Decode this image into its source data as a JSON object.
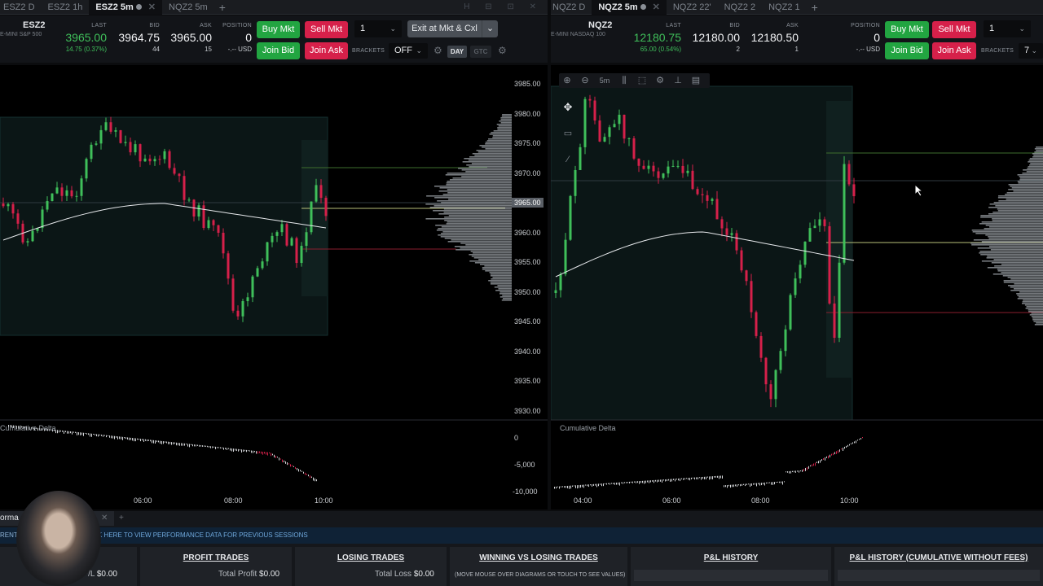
{
  "left_tabs": [
    {
      "label": "ESZ2 D",
      "active": false
    },
    {
      "label": "ESZ2 1h",
      "active": false
    },
    {
      "label": "ESZ2 5m",
      "active": true
    },
    {
      "label": "NQZ2 5m",
      "active": false
    }
  ],
  "right_tabs": [
    {
      "label": "NQZ2 D",
      "active": false
    },
    {
      "label": "NQZ2 5m",
      "active": true
    },
    {
      "label": "NQZ2 22'",
      "active": false
    },
    {
      "label": "NQZ2 2",
      "active": false
    },
    {
      "label": "NQZ2 1",
      "active": false
    }
  ],
  "left_order": {
    "symbol": "ESZ2",
    "symbol_sub": "E-MINI S&P 500",
    "last_label": "LAST",
    "last": "3965.00",
    "last_change": "14.75 (0.37%)",
    "bid_label": "BID",
    "bid": "3964.75",
    "bid_size": "44",
    "ask_label": "ASK",
    "ask": "3965.00",
    "ask_size": "15",
    "position_label": "POSITION",
    "position": "0",
    "position_pnl": "-.-- USD",
    "buy_mkt": "Buy Mkt",
    "sell_mkt": "Sell Mkt",
    "join_bid": "Join Bid",
    "join_ask": "Join Ask",
    "qty": "1",
    "exit_button": "Exit at Mkt & Cxl",
    "brackets_label": "BRACKETS",
    "brackets_value": "OFF",
    "day": "DAY",
    "gtc": "GTC"
  },
  "right_order": {
    "symbol": "NQZ2",
    "symbol_sub": "E-MINI NASDAQ 100",
    "last_label": "LAST",
    "last": "12180.75",
    "last_change": "65.00 (0.54%)",
    "bid_label": "BID",
    "bid": "12180.00",
    "bid_size": "2",
    "ask_label": "ASK",
    "ask": "12180.50",
    "ask_size": "1",
    "position_label": "POSITION",
    "position": "0",
    "position_pnl": "-.-- USD",
    "buy_mkt": "Buy Mkt",
    "sell_mkt": "Sell Mkt",
    "join_bid": "Join Bid",
    "join_ask": "Join Ask",
    "qty": "1",
    "brackets_label": "BRACKETS",
    "brackets_value": "7"
  },
  "left_chart": {
    "price_axis": [
      "3985.00",
      "3980.00",
      "3975.00",
      "3970.00",
      "3965.00",
      "3960.00",
      "3955.00",
      "3950.00",
      "3945.00",
      "3940.00",
      "3935.00",
      "3930.00"
    ],
    "current_price": "3965.00",
    "time_axis": [
      "06:00",
      "08:00",
      "10:00"
    ],
    "cd_title": "Cumulative Delta",
    "cd_axis": [
      "0",
      "-5,000",
      "-10,000"
    ]
  },
  "right_chart": {
    "tool_zoom": "5m",
    "time_axis": [
      "04:00",
      "06:00",
      "08:00",
      "10:00"
    ],
    "cd_title": "Cumulative Delta"
  },
  "bottom": {
    "tab_label": "orma",
    "session_link": "K HERE TO VIEW PERFORMANCE DATA FOR PREVIOUS SESSIONS",
    "rent_label": "RENT",
    "cards": [
      {
        "title": "PROFIT TRADES",
        "sub_label": "Total Profit",
        "sub_value": "$0.00"
      },
      {
        "title": "LOSING TRADES",
        "sub_label": "Total Loss",
        "sub_value": "$0.00"
      },
      {
        "title": "WINNING VS LOSING TRADES",
        "sub_label": "(MOVE MOUSE OVER DIAGRAMS OR TOUCH TO SEE VALUES)",
        "sub_value": ""
      },
      {
        "title": "P&L HISTORY",
        "sub_label": "",
        "sub_value": ""
      },
      {
        "title": "P&L HISTORY (CUMULATIVE WITHOUT FEES)",
        "sub_label": "",
        "sub_value": ""
      }
    ],
    "gross_label": "Gross P/L",
    "gross_value": "$0.00"
  },
  "colors": {
    "up": "#3fbf5a",
    "down": "#d6204a",
    "panel": "#121418",
    "chart_bg": "#000000"
  }
}
